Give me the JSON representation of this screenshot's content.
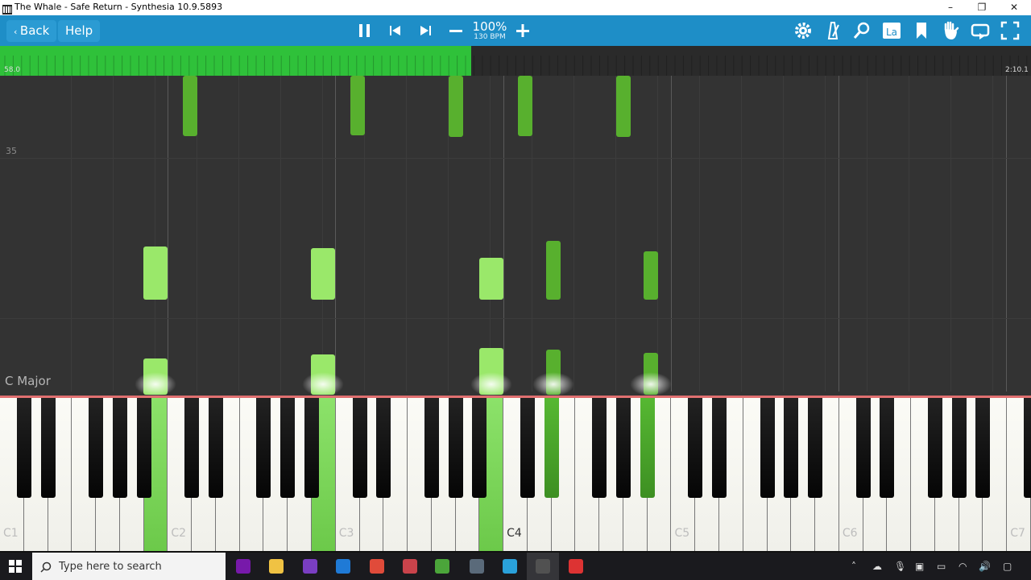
{
  "window": {
    "title": "The Whale - Safe Return - Synthesia 10.9.5893",
    "minimize": "–",
    "restore": "❐",
    "close": "✕"
  },
  "toolbar": {
    "back_label": "Back",
    "help_label": "Help",
    "tempo_percent": "100%",
    "tempo_bpm": "130 BPM",
    "icons": [
      "pause-icon",
      "previous-icon",
      "next-icon",
      "minus-icon",
      "plus-icon",
      "settings-icon",
      "metronome-icon",
      "zoom-icon",
      "label-icon",
      "bookmark-icon",
      "hand-icon",
      "loop-icon",
      "fullscreen-icon"
    ],
    "accent": "#1e8ec7"
  },
  "progress": {
    "start_label": "58.0",
    "end_label": "2:10.1",
    "fraction": 0.457,
    "color": "#2fc13a"
  },
  "roll": {
    "measure_label": "35",
    "key_signature": "C Major",
    "note_color_light": "#9ae86a",
    "note_color_dark": "#58b02e"
  },
  "keyboard": {
    "octave_labels": [
      "C1",
      "C2",
      "C3",
      "C4",
      "C5",
      "C6",
      "C7"
    ]
  },
  "taskbar": {
    "search_placeholder": "Type here to search",
    "apps": [
      "onenote-icon",
      "file-explorer-icon",
      "app-icon",
      "calendar-icon",
      "chrome-icon",
      "app-icon",
      "app-icon",
      "app-icon",
      "telegram-icon",
      "synthesia-icon",
      "recorder-icon"
    ]
  }
}
